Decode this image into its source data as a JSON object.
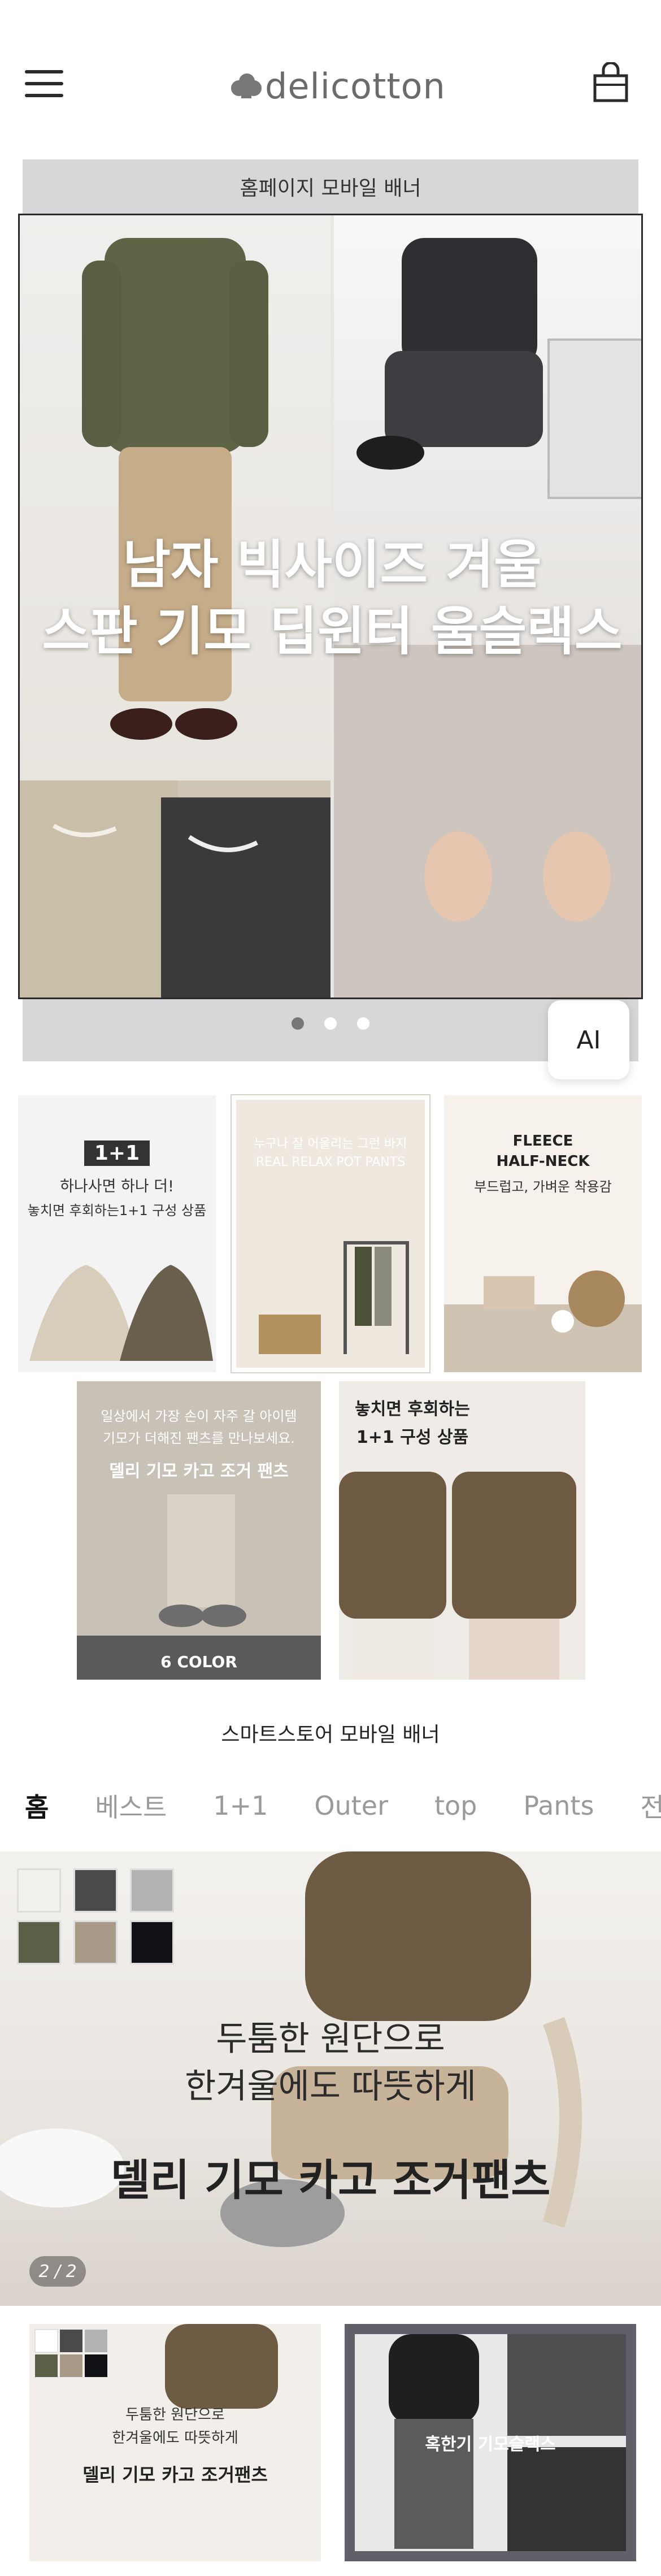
{
  "header": {
    "logo_text": "delicotton",
    "menu_icon": "hamburger-icon",
    "cart_icon": "shopping-bag-icon"
  },
  "banner1": {
    "title": "홈페이지 모바일 배너",
    "slide_caption_line1": "남자 빅사이즈 겨울",
    "slide_caption_line2": "스판 기모 딥윈터 울슬랙스",
    "dots_count": 3,
    "active_dot": 1
  },
  "ai_button": {
    "label": "AI"
  },
  "products": [
    {
      "badge": "1+1",
      "line1": "하나사면 하나 더!",
      "line2": "놓치면 후회하는1+1 구성 상품"
    },
    {
      "line1": "누구나 잘 어울리는 그런 바지",
      "line2": "REAL RELAX POT PANTS"
    },
    {
      "line1": "FLEECE",
      "line2": "HALF-NECK",
      "line3": "부드럽고, 가벼운 착용감"
    },
    {
      "line1": "일상에서 가장 손이 자주 갈 아이템",
      "line2": "기모가 더해진 팬츠를 만나보세요.",
      "title": "델리 기모 카고 조거 팬츠",
      "footer": "6 COLOR"
    },
    {
      "line1": "놓치면 후회하는",
      "line2": "1+1 구성 상품"
    }
  ],
  "smartstore": {
    "title": "스마트스토어 모바일 배너",
    "tabs": [
      "홈",
      "베스트",
      "1+1",
      "Outer",
      "top",
      "Pants",
      "전체"
    ],
    "active_tab": 0
  },
  "promo": {
    "text_line1": "두툼한 원단으로",
    "text_line2": "한겨울에도 따뜻하게",
    "title": "델리 기모 카고 조거팬츠",
    "pager": "2 / 2",
    "swatch_colors": [
      "#f3f1ec",
      "#4a4a4a",
      "#b3b3b3",
      "#5a5f45",
      "#a89a86",
      "#0f1114"
    ]
  },
  "thumbs": [
    {
      "line1": "두툼한 원단으로",
      "line2": "한겨울에도 따뜻하게",
      "title": "델리 기모 카고 조거팬츠"
    },
    {
      "title": "혹한기 기모슬랙스"
    }
  ]
}
